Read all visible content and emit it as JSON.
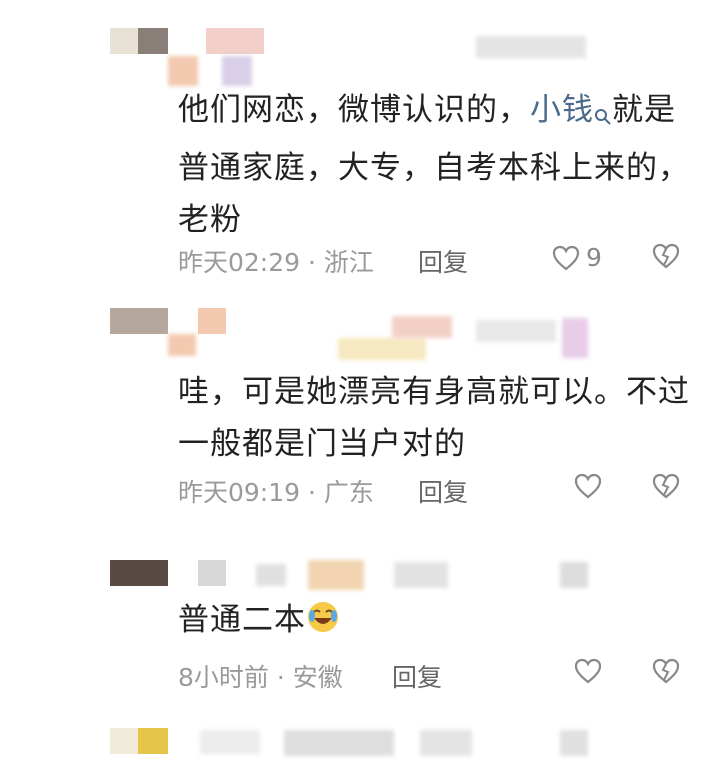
{
  "comments": [
    {
      "text_before": "他们网恋，微博认识的，",
      "mention": "小钱",
      "text_after": "就是普通家庭，大专，自考本科上来的，老粉",
      "time": "昨天02:29",
      "location": "浙江",
      "reply_label": "回复",
      "like_count": "9"
    },
    {
      "text": "哇，可是她漂亮有身高就可以。不过一般都是门当户对的",
      "time": "昨天09:19",
      "location": "广东",
      "reply_label": "回复",
      "like_count": ""
    },
    {
      "text": "普通二本",
      "time": "8小时前",
      "location": "安徽",
      "reply_label": "回复",
      "like_count": ""
    }
  ],
  "separator": " · ",
  "colors": {
    "text": "#222222",
    "meta": "#9a9a9a",
    "mention": "#4a6b8a",
    "icon": "#888888"
  }
}
